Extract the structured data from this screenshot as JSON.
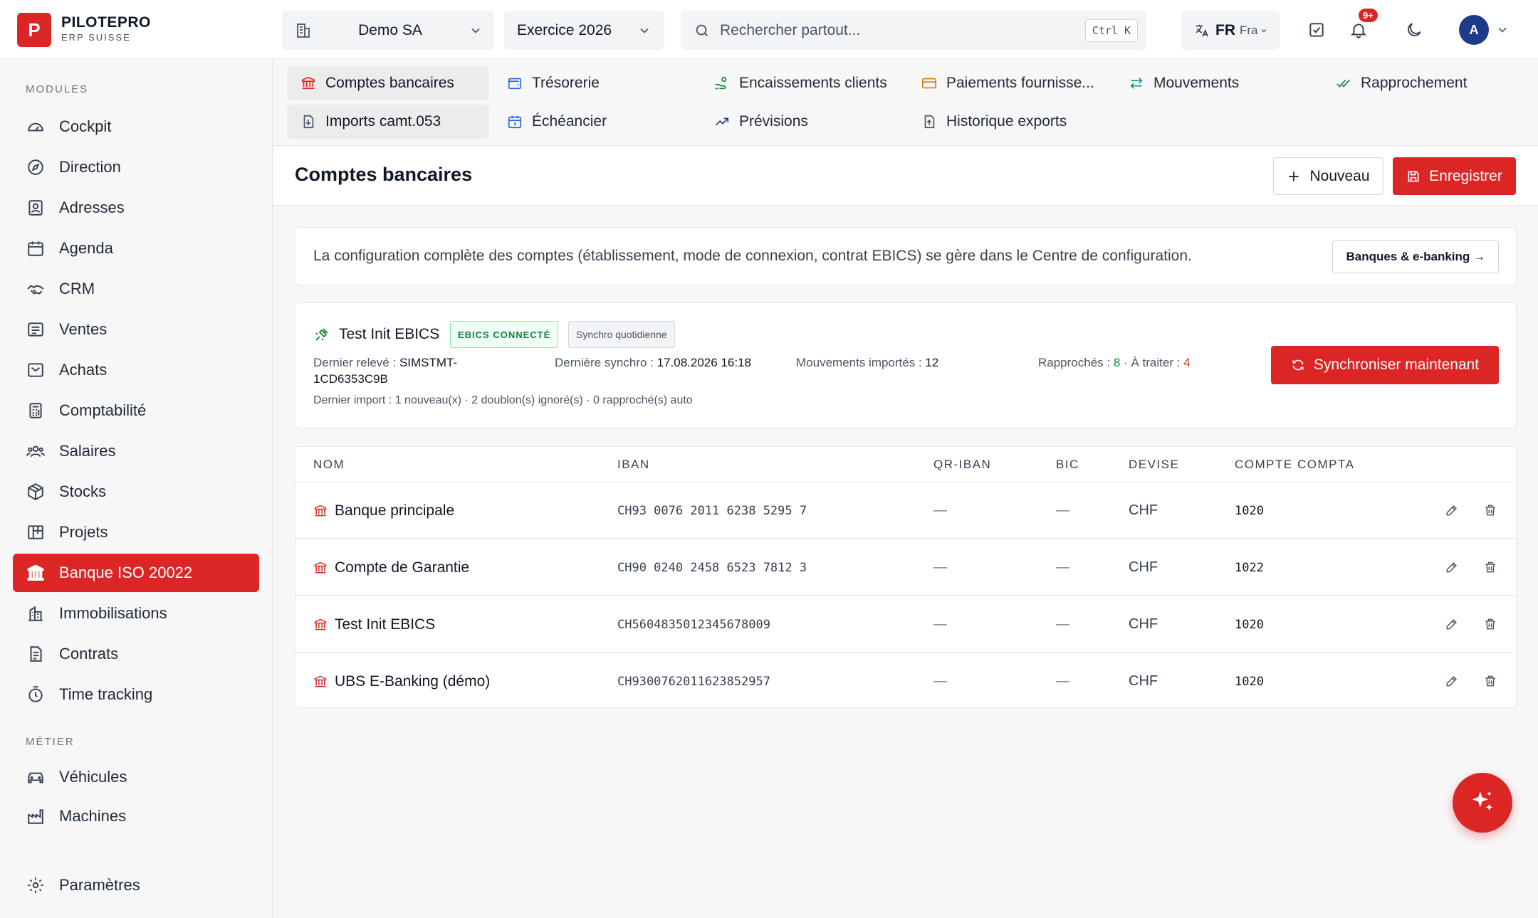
{
  "brand": {
    "logo_letter": "P",
    "name": "PILOTEPRO",
    "subtitle": "ERP SUISSE"
  },
  "header": {
    "company": "Demo SA",
    "year": "Exercice 2026",
    "search_placeholder": "Rechercher partout...",
    "shortcut": "Ctrl K",
    "lang_code": "FR",
    "lang_name": "Fra",
    "notifications_badge": "9+",
    "avatar_initial": "A"
  },
  "sidebar": {
    "section_modules": "MODULES",
    "section_metier": "MÉTIER",
    "modules": [
      {
        "label": "Cockpit",
        "icon": "gauge-icon"
      },
      {
        "label": "Direction",
        "icon": "compass-icon"
      },
      {
        "label": "Adresses",
        "icon": "contact-card-icon"
      },
      {
        "label": "Agenda",
        "icon": "calendar-icon"
      },
      {
        "label": "CRM",
        "icon": "handshake-icon"
      },
      {
        "label": "Ventes",
        "icon": "receipt-icon"
      },
      {
        "label": "Achats",
        "icon": "inbox-icon"
      },
      {
        "label": "Comptabilité",
        "icon": "calculator-icon"
      },
      {
        "label": "Salaires",
        "icon": "users-icon"
      },
      {
        "label": "Stocks",
        "icon": "package-icon"
      },
      {
        "label": "Projets",
        "icon": "kanban-icon"
      },
      {
        "label": "Banque ISO 20022",
        "icon": "bank-icon",
        "active": true
      },
      {
        "label": "Immobilisations",
        "icon": "building-icon"
      },
      {
        "label": "Contrats",
        "icon": "contract-icon"
      },
      {
        "label": "Time tracking",
        "icon": "timer-icon"
      }
    ],
    "metier": [
      {
        "label": "Véhicules",
        "icon": "car-icon"
      },
      {
        "label": "Machines",
        "icon": "factory-icon"
      }
    ],
    "settings": "Paramètres"
  },
  "subnav": {
    "tabs": [
      {
        "label": "Comptes bancaires",
        "icon": "bank-icon",
        "active": true
      },
      {
        "label": "Trésorerie",
        "icon": "wallet-icon"
      },
      {
        "label": "Encaissements clients",
        "icon": "hand-coins-icon"
      },
      {
        "label": "Paiements fournisse...",
        "icon": "credit-card-icon"
      },
      {
        "label": "Mouvements",
        "icon": "arrows-left-right-icon"
      },
      {
        "label": "Rapprochement",
        "icon": "double-check-icon"
      },
      {
        "label": "Imports camt.053",
        "icon": "file-import-icon"
      },
      {
        "label": "Échéancier",
        "icon": "calendar-clock-icon"
      },
      {
        "label": "Prévisions",
        "icon": "trend-up-icon"
      },
      {
        "label": "Historique exports",
        "icon": "file-export-icon"
      }
    ]
  },
  "page": {
    "title": "Comptes bancaires",
    "new_label": "Nouveau",
    "save_label": "Enregistrer"
  },
  "info": {
    "text": "La configuration complète des comptes (établissement, mode de connexion, contrat EBICS) se gère dans le Centre de configuration.",
    "button": "Banques & e-banking →"
  },
  "ebics": {
    "title": "Test Init EBICS",
    "tag_status": "EBICS CONNECTÉ",
    "tag_sync": "Synchro quotidienne",
    "last_statement_label": "Dernier relevé :",
    "last_statement_value_1": "SIMSTMT-",
    "last_statement_value_2": "1CD6353C9B",
    "last_sync_label": "Dernière synchro :",
    "last_sync_value": "17.08.2026 16:18",
    "imported_label": "Mouvements importés :",
    "imported_value": "12",
    "matched_label": "Rapprochés :",
    "matched_value": "8",
    "separator": "·",
    "pending_label": "À traiter :",
    "pending_value": "4",
    "last_import": "Dernier import : 1 nouveau(x) · 2 doublon(s) ignoré(s) · 0 rapproché(s) auto",
    "sync_button": "Synchroniser maintenant"
  },
  "table": {
    "headers": {
      "name": "NOM",
      "iban": "IBAN",
      "qr": "QR-IBAN",
      "bic": "BIC",
      "currency": "DEVISE",
      "account": "COMPTE COMPTA"
    },
    "rows": [
      {
        "name": "Banque principale",
        "iban": "CH93 0076 2011 6238 5295 7",
        "qr": "—",
        "bic": "—",
        "currency": "CHF",
        "account": "1020"
      },
      {
        "name": "Compte de Garantie",
        "iban": "CH90 0240 2458 6523 7812 3",
        "qr": "—",
        "bic": "—",
        "currency": "CHF",
        "account": "1022"
      },
      {
        "name": "Test Init EBICS",
        "iban": "CH5604835012345678009",
        "qr": "—",
        "bic": "—",
        "currency": "CHF",
        "account": "1020"
      },
      {
        "name": "UBS E-Banking (démo)",
        "iban": "CH9300762011623852957",
        "qr": "—",
        "bic": "—",
        "currency": "CHF",
        "account": "1020"
      }
    ]
  },
  "colors": {
    "accent": "#dc2626",
    "success": "#15803d",
    "warning": "#c2410c",
    "navy": "#1e3a8a"
  }
}
